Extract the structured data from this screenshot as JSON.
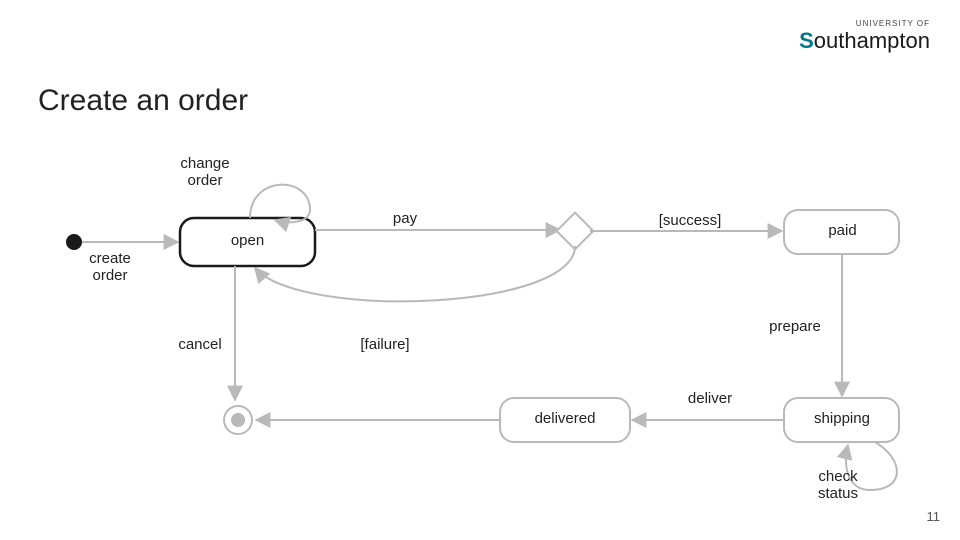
{
  "header": {
    "title": "Create an order",
    "logo_top": "UNIVERSITY OF",
    "logo_name_rest": "outhampton"
  },
  "page_number": "11",
  "labels": {
    "change_order": "change\norder",
    "create_order": "create\norder",
    "open": "open",
    "pay": "pay",
    "success": "[success]",
    "paid": "paid",
    "prepare": "prepare",
    "cancel": "cancel",
    "failure": "[failure]",
    "deliver": "deliver",
    "delivered": "delivered",
    "shipping": "shipping",
    "check_status": "check\nstatus"
  },
  "chart_data": {
    "type": "state_machine",
    "title": "Create an order",
    "initial_state": "initial",
    "final_state": "final",
    "states": [
      "open",
      "paid",
      "shipping",
      "delivered"
    ],
    "decision_nodes": [
      "pay_outcome"
    ],
    "transitions": [
      {
        "from": "initial",
        "to": "open",
        "label": "create order"
      },
      {
        "from": "open",
        "to": "open",
        "label": "change order"
      },
      {
        "from": "open",
        "to": "pay_outcome",
        "label": "pay"
      },
      {
        "from": "pay_outcome",
        "to": "paid",
        "guard": "[success]"
      },
      {
        "from": "pay_outcome",
        "to": "open",
        "guard": "[failure]"
      },
      {
        "from": "paid",
        "to": "shipping",
        "label": "prepare"
      },
      {
        "from": "shipping",
        "to": "shipping",
        "label": "check status"
      },
      {
        "from": "shipping",
        "to": "delivered",
        "label": "deliver"
      },
      {
        "from": "open",
        "to": "final",
        "label": "cancel"
      },
      {
        "from": "delivered",
        "to": "final"
      }
    ]
  }
}
